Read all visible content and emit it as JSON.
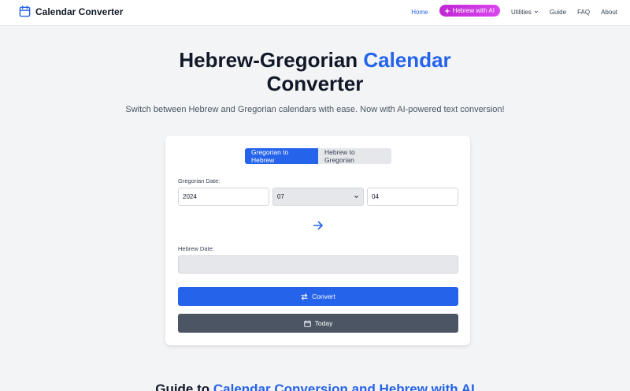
{
  "brand": {
    "name": "Calendar Converter",
    "icon": "calendar-icon"
  },
  "nav": {
    "home": "Home",
    "ai": "Hebrew with AI",
    "utilities": "Utilities",
    "guide": "Guide",
    "faq": "FAQ",
    "about": "About"
  },
  "hero": {
    "title_part1": "Hebrew-Gregorian ",
    "title_accent": "Calendar",
    "title_part2": "Converter",
    "subtitle": "Switch between Hebrew and Gregorian calendars with ease. Now with AI-powered text conversion!"
  },
  "converter": {
    "tabs": [
      "Gregorian to Hebrew",
      "Hebrew to Gregorian"
    ],
    "active_tab": "Gregorian to Hebrew",
    "gregorian_label": "Gregorian Date:",
    "year": "2024",
    "month": "07",
    "day": "04",
    "hebrew_label": "Hebrew Date:",
    "hebrew_value": "",
    "convert_label": "Convert",
    "today_label": "Today"
  },
  "guide": {
    "prefix": "Guide to ",
    "accent": "Calendar Conversion and Hebrew with AI"
  },
  "colors": {
    "accent": "#2563eb",
    "ai_pill": "#d946ef",
    "today_button": "#4b5563",
    "background": "#f3f4f6"
  }
}
